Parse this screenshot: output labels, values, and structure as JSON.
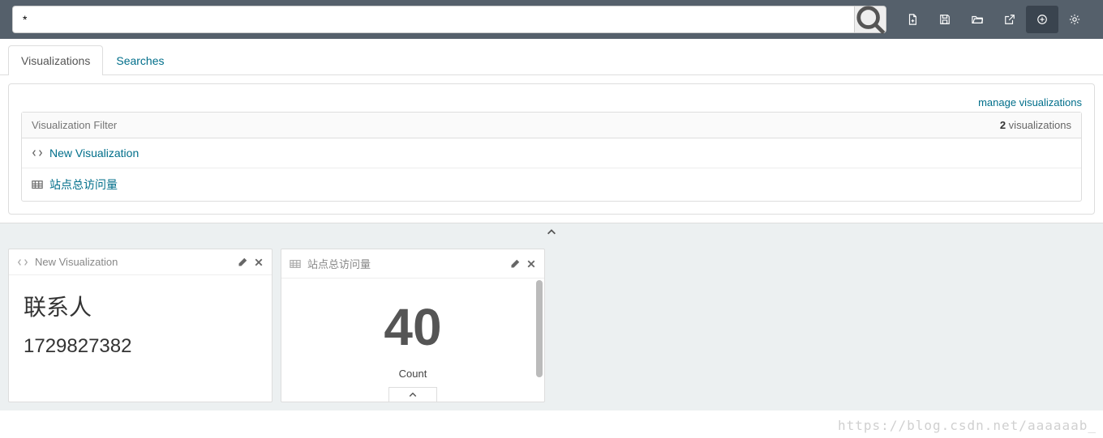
{
  "search": {
    "value": "*"
  },
  "tabs": {
    "items": [
      {
        "label": "Visualizations",
        "active": true
      },
      {
        "label": "Searches",
        "active": false
      }
    ]
  },
  "panel": {
    "manage_link": "manage visualizations",
    "filter_placeholder": "Visualization Filter",
    "count_num": "2",
    "count_label": " visualizations",
    "items": [
      {
        "icon": "code",
        "name": "New Visualization"
      },
      {
        "icon": "table",
        "name": "站点总访问量"
      }
    ]
  },
  "widgets": [
    {
      "icon": "code",
      "title": "New Visualization",
      "body_type": "markdown",
      "heading": "联系人",
      "text": "1729827382"
    },
    {
      "icon": "table",
      "title": "站点总访问量",
      "body_type": "metric",
      "value": "40",
      "label": "Count"
    }
  ],
  "watermark": "https://blog.csdn.net/aaaaaab_"
}
